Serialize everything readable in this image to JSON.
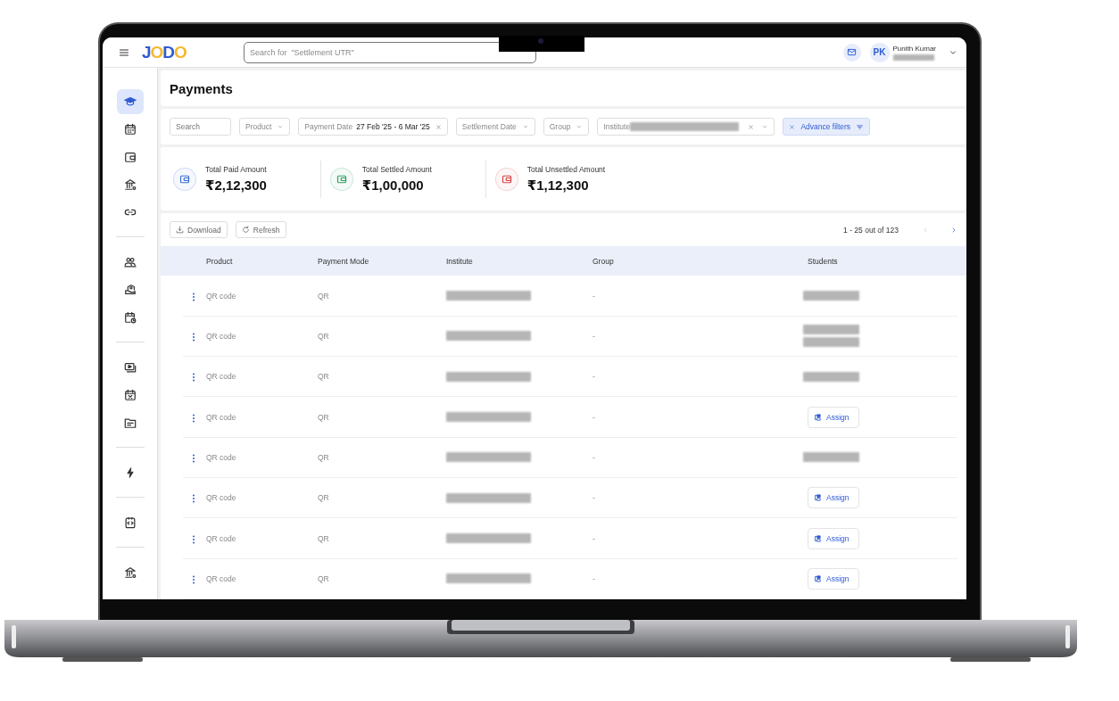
{
  "topbar": {
    "logo": "JODO",
    "search": {
      "placeholder": "Search for  \"Settlement UTR\""
    },
    "user": {
      "initials": "PK",
      "name": "Punith Kumar"
    }
  },
  "sidebar": {
    "items": [
      {
        "kind": "cap",
        "selected": true
      },
      {
        "kind": "calendar",
        "selected": false
      },
      {
        "kind": "wallet",
        "selected": false
      },
      {
        "kind": "bank",
        "selected": false
      },
      {
        "kind": "link",
        "selected": false
      },
      {
        "kind": "divider"
      },
      {
        "kind": "users",
        "selected": false
      },
      {
        "kind": "hand",
        "selected": false
      },
      {
        "kind": "calendar-clock",
        "selected": false
      },
      {
        "kind": "divider"
      },
      {
        "kind": "screen",
        "selected": false
      },
      {
        "kind": "calendar-x",
        "selected": false
      },
      {
        "kind": "folder",
        "selected": false
      },
      {
        "kind": "divider"
      },
      {
        "kind": "bolt",
        "selected": false
      },
      {
        "kind": "divider"
      },
      {
        "kind": "code",
        "selected": false
      },
      {
        "kind": "divider"
      },
      {
        "kind": "bank",
        "selected": false
      }
    ]
  },
  "page": {
    "title": "Payments"
  },
  "filters": [
    {
      "kind": "search",
      "placeholder": "Search"
    },
    {
      "kind": "dropdown",
      "label": "Product"
    },
    {
      "kind": "range",
      "label": "Payment Date",
      "value": "27 Feb '25 - 6 Mar '25"
    },
    {
      "kind": "dropdown",
      "label": "Settlement Date"
    },
    {
      "kind": "dropdown",
      "label": "Group"
    },
    {
      "kind": "redacted",
      "label": "Institute"
    },
    {
      "kind": "advance",
      "label": "Advance filters"
    }
  ],
  "summary": [
    {
      "label": "Total Paid Amount",
      "value": "₹2,12,300",
      "color": "#3b6fd8"
    },
    {
      "label": "Total Settled  Amount",
      "value": "₹1,00,000",
      "color": "#2e9e63"
    },
    {
      "label": "Total Unsettled  Amount",
      "value": "₹1,12,300",
      "color": "#d64545"
    }
  ],
  "toolbar": {
    "buttons": [
      {
        "kind": "download",
        "label": "Download"
      },
      {
        "kind": "refresh",
        "label": "Refresh"
      }
    ],
    "pagination": "1 - 25 out of 123"
  },
  "table": {
    "columns": [
      "Product",
      "Payment Mode",
      "Institute",
      "Group",
      "Students"
    ],
    "rows": [
      {
        "product": "QR code",
        "mode": "QR",
        "institute": {
          "kind": "redacted"
        },
        "group": "-",
        "students": {
          "kind": "redacted"
        }
      },
      {
        "product": "QR code",
        "mode": "QR",
        "institute": {
          "kind": "redacted"
        },
        "group": "-",
        "students": {
          "kind": "redacted-double"
        }
      },
      {
        "product": "QR code",
        "mode": "QR",
        "institute": {
          "kind": "redacted"
        },
        "group": "-",
        "students": {
          "kind": "redacted"
        }
      },
      {
        "product": "QR code",
        "mode": "QR",
        "institute": {
          "kind": "redacted"
        },
        "group": "-",
        "students": {
          "kind": "assign",
          "label": "Assign"
        }
      },
      {
        "product": "QR code",
        "mode": "QR",
        "institute": {
          "kind": "redacted"
        },
        "group": "-",
        "students": {
          "kind": "redacted"
        }
      },
      {
        "product": "QR code",
        "mode": "QR",
        "institute": {
          "kind": "redacted"
        },
        "group": "-",
        "students": {
          "kind": "assign",
          "label": "Assign"
        }
      },
      {
        "product": "QR code",
        "mode": "QR",
        "institute": {
          "kind": "redacted"
        },
        "group": "-",
        "students": {
          "kind": "assign",
          "label": "Assign"
        }
      },
      {
        "product": "QR code",
        "mode": "QR",
        "institute": {
          "kind": "redacted"
        },
        "group": "-",
        "students": {
          "kind": "assign",
          "label": "Assign"
        }
      }
    ]
  }
}
